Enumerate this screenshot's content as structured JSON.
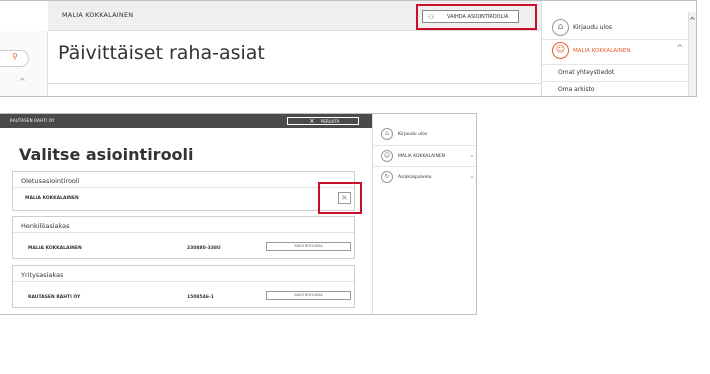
{
  "top_panel": {
    "user_name": "MALIA KOKKALAINEN",
    "change_role_label": "VAIHDA ASIOINTIROOLIA",
    "page_title": "Päivittäiset raha-asiat",
    "side_menu": {
      "logout": "Kirjaudu ulos",
      "user": "MALIA KOKKALAINEN",
      "contact_info": "Omat yhteystiedot",
      "archive": "Oma arkisto"
    }
  },
  "bottom_panel": {
    "company_name": "RAUTASEN RAHTI OY",
    "cancel_label": "PERUUTA",
    "page_title": "Valitse asiointirooli",
    "default_role": {
      "heading": "Oletusasiointirooli",
      "name": "MALIA KOKKALAINEN"
    },
    "personal_customer": {
      "heading": "Henkilöasiakas",
      "name": "MALIA KOKKALAINEN",
      "id": "230880-338U",
      "action": "ASIOI ROOLISSA"
    },
    "business_customer": {
      "heading": "Yritysasiakas",
      "name": "RAUTASEN RAHTI OY",
      "id": "1508546-1",
      "action": "ASIOI ROOLISSA"
    },
    "side_menu": {
      "logout": "Kirjaudu ulos",
      "user": "MALIA KOKKALAINEN",
      "service": "Asiakaspalvelu"
    }
  },
  "colors": {
    "accent": "#e2602a",
    "highlight_box": "#c8102e",
    "dark_bar": "#4a4a4a"
  }
}
